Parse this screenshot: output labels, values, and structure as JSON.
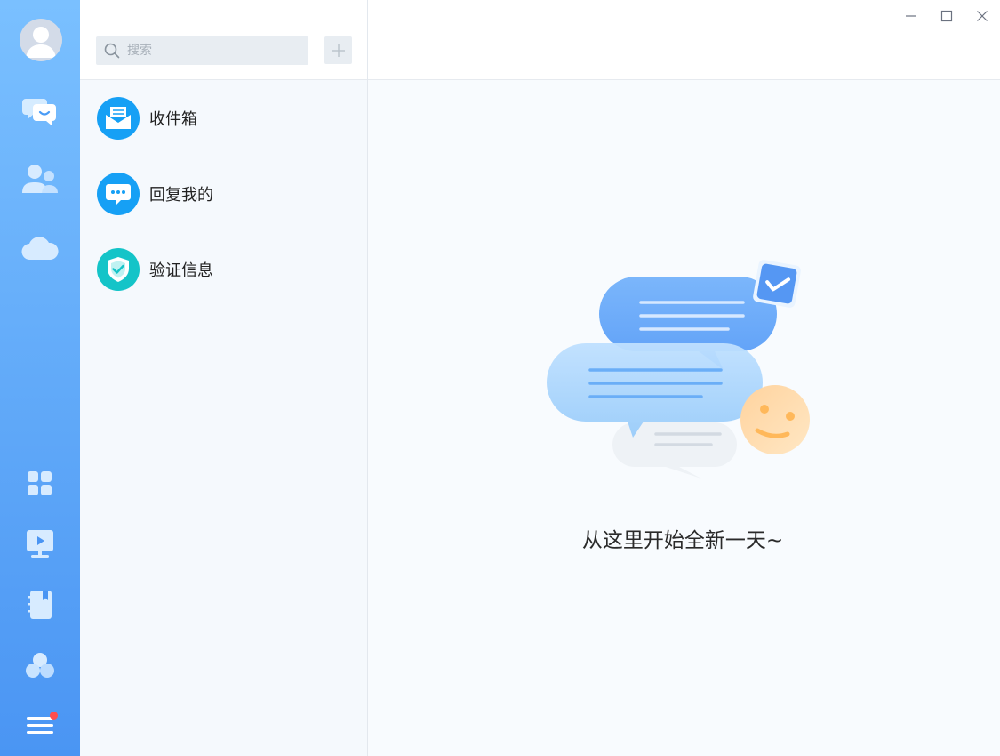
{
  "search": {
    "placeholder": "搜索"
  },
  "list": {
    "items": [
      {
        "label": "收件箱",
        "icon": "inbox-icon",
        "color": "#16a0f5"
      },
      {
        "label": "回复我的",
        "icon": "reply-chat-icon",
        "color": "#16a0f5"
      },
      {
        "label": "验证信息",
        "icon": "shield-check-icon",
        "color": "#14c4c8"
      }
    ]
  },
  "main": {
    "empty_text": "从这里开始全新一天~"
  },
  "colors": {
    "rail_top": "#7ac0ff",
    "rail_bottom": "#4a95f3",
    "accent": "#16a0f5",
    "badge": "#ff4d4f"
  }
}
